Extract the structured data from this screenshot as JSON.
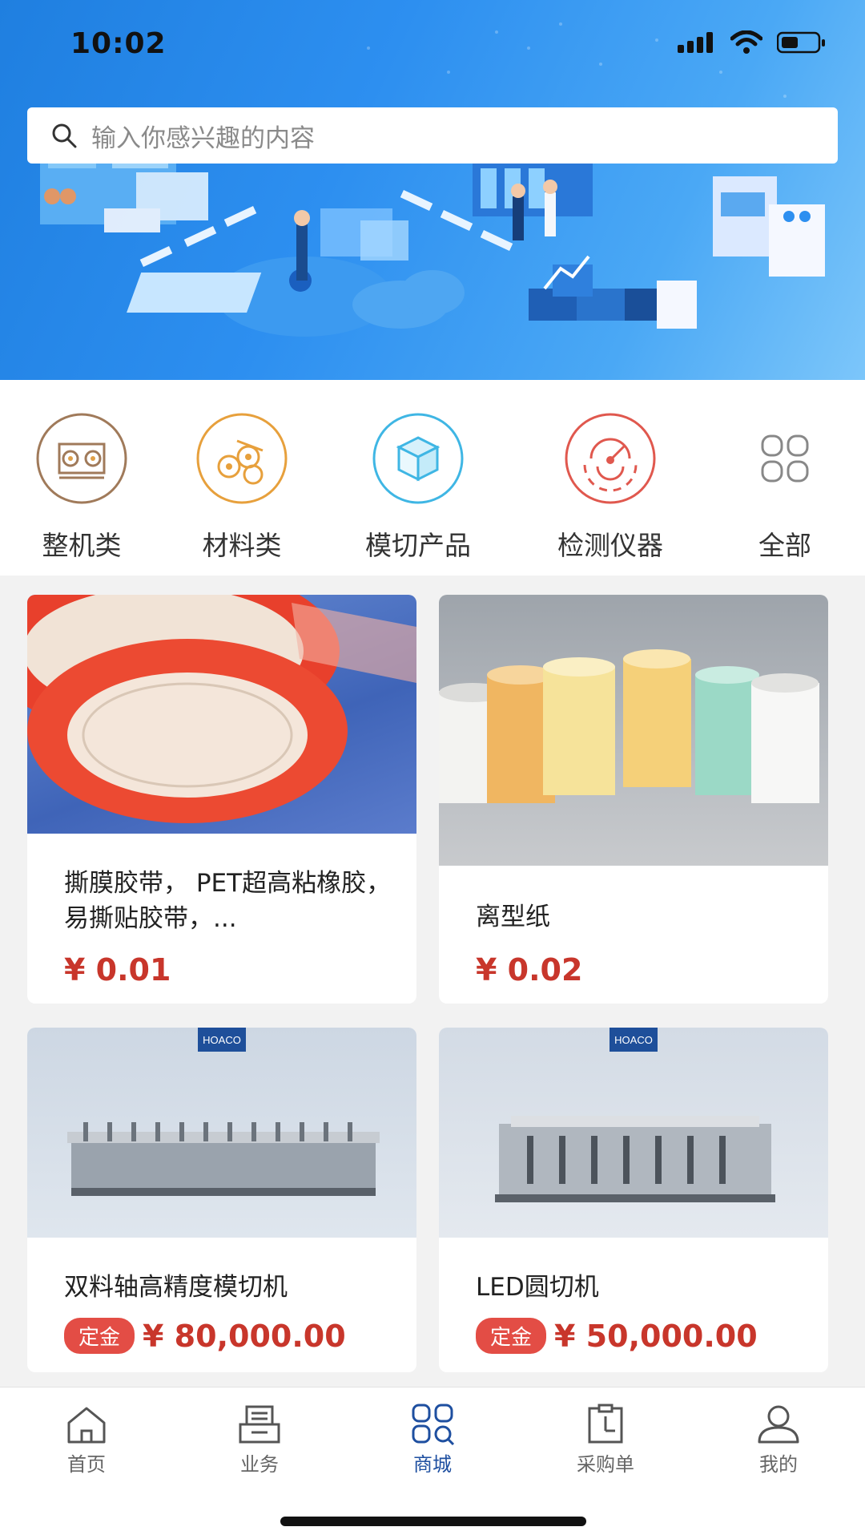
{
  "status_bar": {
    "time": "10:02"
  },
  "search": {
    "placeholder": "输入你感兴趣的内容"
  },
  "categories": [
    {
      "label": "整机类",
      "icon": "machine-icon"
    },
    {
      "label": "材料类",
      "icon": "material-rolls-icon"
    },
    {
      "label": "模切产品",
      "icon": "box-icon"
    },
    {
      "label": "检测仪器",
      "icon": "radar-icon"
    },
    {
      "label": "全部",
      "icon": "grid-icon"
    }
  ],
  "products": [
    {
      "title": "撕膜胶带， PET超高粘橡胶，易撕贴胶带，...",
      "price": "¥ 0.01",
      "deposit": ""
    },
    {
      "title": "离型纸",
      "price": "¥ 0.02",
      "deposit": ""
    },
    {
      "title": "双料轴高精度模切机",
      "price": "¥ 80,000.00",
      "deposit": "定金",
      "brand": "HOACO"
    },
    {
      "title": "LED圆切机",
      "price": "¥ 50,000.00",
      "deposit": "定金",
      "brand": "HOACO"
    }
  ],
  "tabbar": [
    {
      "label": "首页",
      "icon": "home-icon",
      "active": false
    },
    {
      "label": "业务",
      "icon": "business-icon",
      "active": false
    },
    {
      "label": "商城",
      "icon": "mall-icon",
      "active": true
    },
    {
      "label": "采购单",
      "icon": "purchase-order-icon",
      "active": false
    },
    {
      "label": "我的",
      "icon": "user-icon",
      "active": false
    }
  ],
  "colors": {
    "accent": "#1e4fa0",
    "price": "#c8362b",
    "deposit_bg": "#e34d45",
    "banner": "#2d8ff0"
  }
}
